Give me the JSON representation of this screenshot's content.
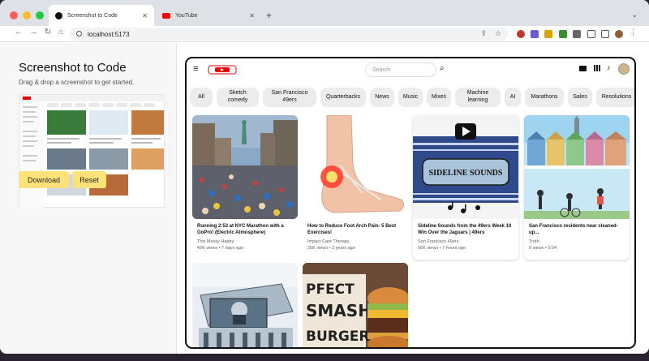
{
  "browser": {
    "tabs": [
      {
        "title": "Screenshot to Code",
        "active": true
      },
      {
        "title": "YouTube",
        "active": false
      }
    ],
    "url": "localhost:5173"
  },
  "sidebar": {
    "title": "Screenshot to Code",
    "subtitle": "Drag & drop a screenshot to get started.",
    "download_label": "Download",
    "reset_label": "Reset"
  },
  "youtube": {
    "search_placeholder": "Search",
    "chips": [
      "All",
      "Sketch\ncomedy",
      "San Francisco\n49ers",
      "Quarterbacks",
      "News",
      "Music",
      "Mixes",
      "Machine\nlearning",
      "AI",
      "Marathons",
      "Sales",
      "Resolutions"
    ],
    "videos": [
      {
        "title": "Running 2:53 at NYC Marathon with a GoPro! (Electric Atmosphere)",
        "channel": "This Messy Happy.",
        "meta": "42K views • 7 days ago"
      },
      {
        "title": "How to Reduce Foot Arch Pain- 5 Best Exercises!",
        "channel": "Impact Care Therapy",
        "meta": "25K views • 2 years ago"
      },
      {
        "title": "Sideline Sounds from the 49ers Week 10 Win Over the Jaguars | 49ers",
        "channel": "San Francisco 49ers",
        "meta": "56K views • 7 hours ago"
      },
      {
        "title": "San Francisco residents near cleaned-up...",
        "channel": "Truth",
        "meta": "8 views • 0:04"
      }
    ],
    "thumb_texts": {
      "sideline": "SIDELINE SOUNDS",
      "burger_line1": "PFECT",
      "burger_line2": "SMASH",
      "burger_line3": "BURGER"
    }
  },
  "colors": {
    "button_yellow": "#fde27a",
    "yt_red": "#ff0000",
    "chip_bg": "#ececec"
  }
}
